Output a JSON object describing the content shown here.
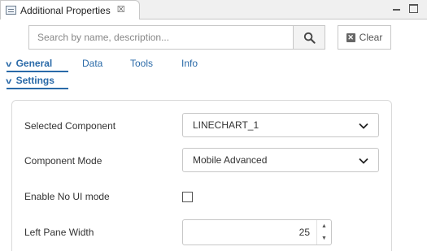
{
  "view": {
    "title": "Additional Properties",
    "close_glyph": "☒"
  },
  "search": {
    "placeholder": "Search by name, description...",
    "value": "",
    "clear_label": "Clear"
  },
  "category_tabs": [
    {
      "label": "General",
      "active": true
    },
    {
      "label": "Data",
      "active": false
    },
    {
      "label": "Tools",
      "active": false
    },
    {
      "label": "Info",
      "active": false
    }
  ],
  "section": {
    "label": "Settings"
  },
  "settings": {
    "selected_component": {
      "label": "Selected Component",
      "value": "LINECHART_1"
    },
    "component_mode": {
      "label": "Component Mode",
      "value": "Mobile Advanced"
    },
    "enable_no_ui": {
      "label": "Enable No UI mode",
      "checked": false
    },
    "left_pane_width": {
      "label": "Left Pane Width",
      "value": "25"
    }
  },
  "icons": {
    "view_icon": "properties-view-icon",
    "search": "search-icon",
    "clear": "clear-x-icon",
    "caret": "chevron-down-icon"
  },
  "colors": {
    "accent": "#2a6aa8",
    "border": "#c7c7c7"
  }
}
